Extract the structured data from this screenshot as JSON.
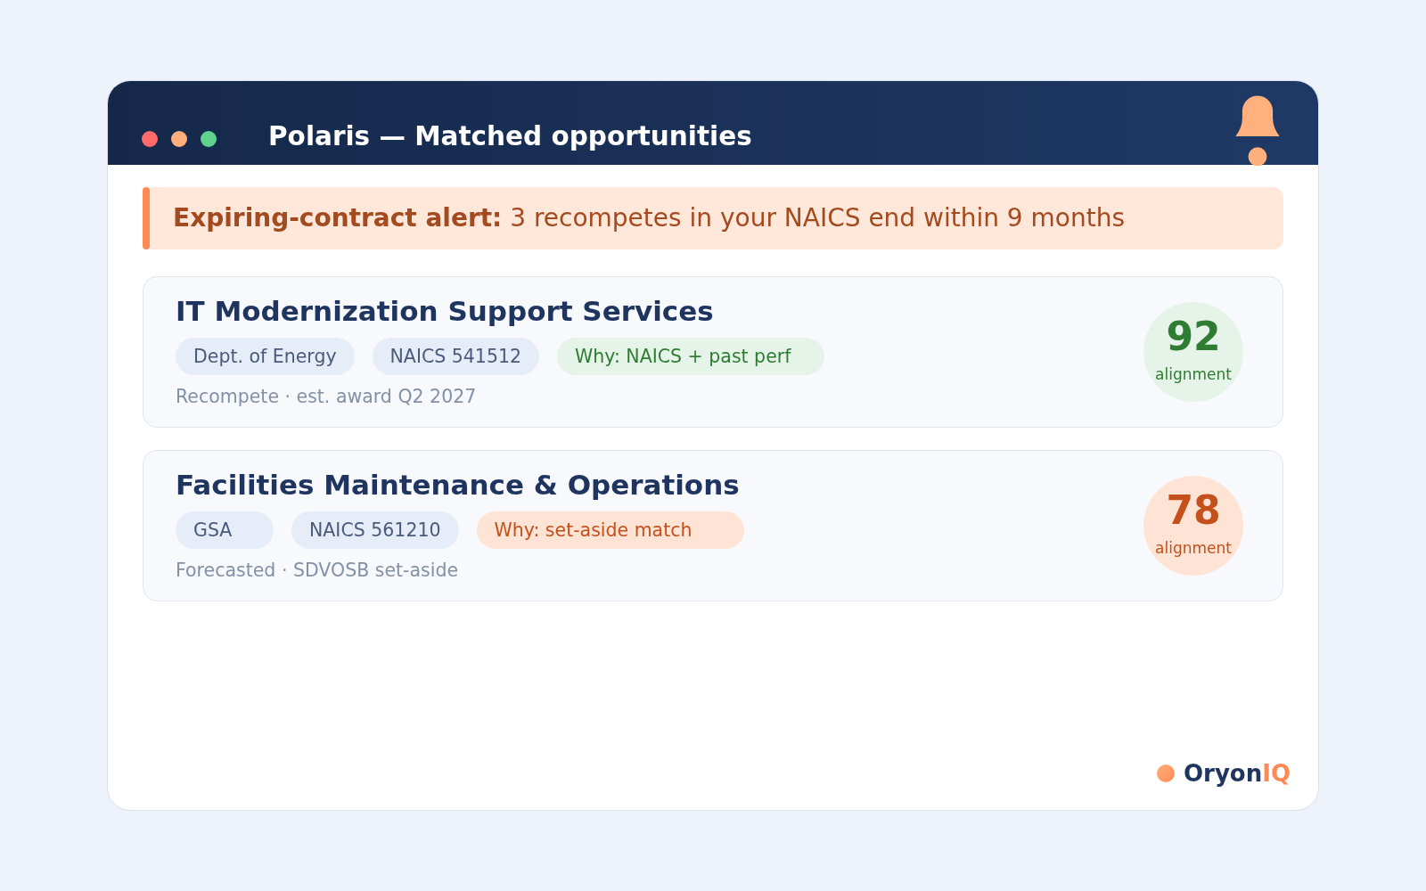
{
  "window": {
    "title": "Polaris — Matched opportunities",
    "controls": [
      {
        "color": "#ff6b6b"
      },
      {
        "color": "#ffb07c"
      },
      {
        "color": "#5fd38d"
      }
    ]
  },
  "alert": {
    "text": "**Expiring-contract alert:** 3 recompetes in your NAICS end within 9 months"
  },
  "opportunities": [
    {
      "title": "IT Modernization Support Services",
      "tags": [
        "Dept. of Energy",
        "NAICS 541512"
      ],
      "why": "Why: NAICS + past perf",
      "meta": "Recompete · est. award Q2 2027",
      "score": "92",
      "score_label": "alignment",
      "kind": "good"
    },
    {
      "title": "Facilities Maintenance & Operations",
      "tags": [
        "GSA",
        "NAICS 561210"
      ],
      "why": "Why: set-aside match",
      "meta": "Forecasted · SDVOSB set-aside",
      "score": "78",
      "score_label": "alignment",
      "kind": "warn"
    }
  ],
  "brand": {
    "name": "Oryon",
    "accent": "IQ"
  }
}
